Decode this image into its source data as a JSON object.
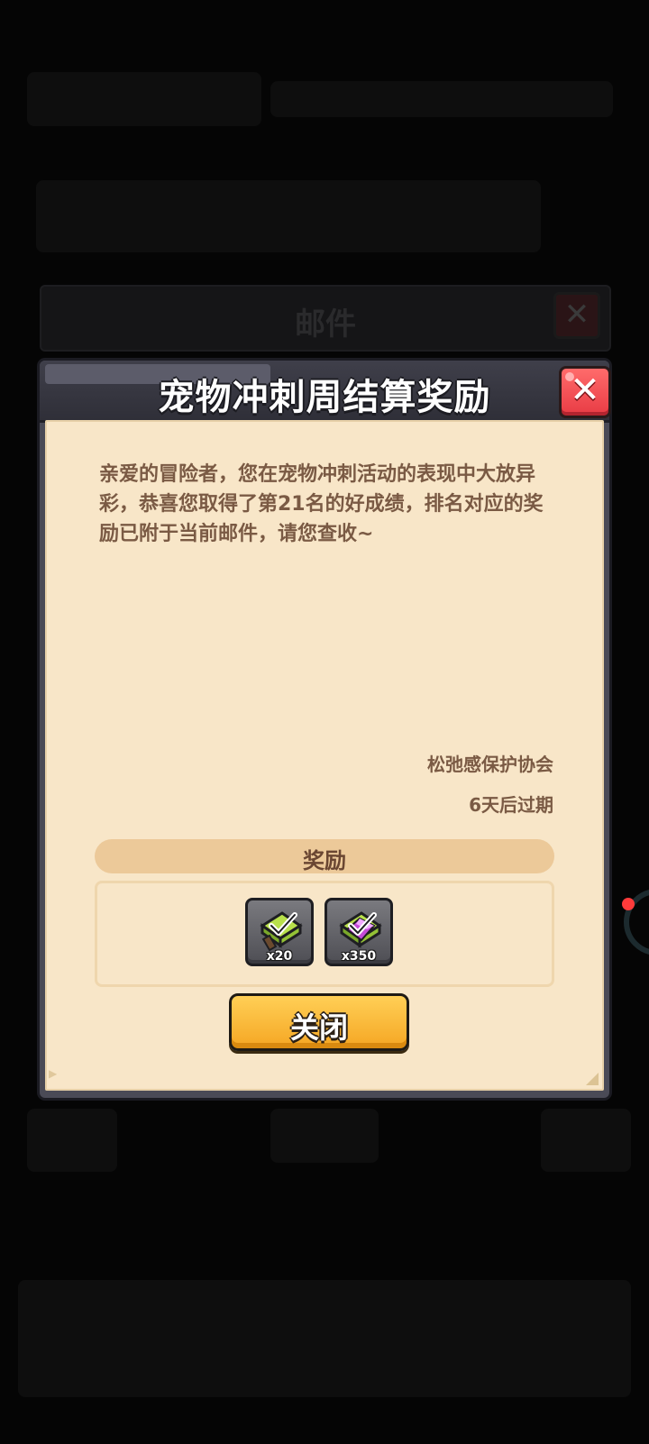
{
  "background": {
    "mail_window_title": "邮件"
  },
  "dialog": {
    "title": "宠物冲刺周结算奖励",
    "message": "亲爱的冒险者，您在宠物冲刺活动的表现中大放异彩，恭喜您取得了第21名的好成绩，排名对应的奖励已附于当前邮件，请您查收~",
    "sender": "松弛感保护协会",
    "expiry": "6天后过期",
    "rewards_label": "奖励",
    "rewards": [
      {
        "icon": "green-ticket-icon",
        "count": "x20"
      },
      {
        "icon": "purple-gem-ticket-icon",
        "count": "x350"
      }
    ],
    "close_label": "关闭"
  },
  "colors": {
    "paper": "#f8e6c8",
    "text_brown": "#7a5a44",
    "button_yellow": "#f5a623",
    "close_red": "#e83b44"
  }
}
